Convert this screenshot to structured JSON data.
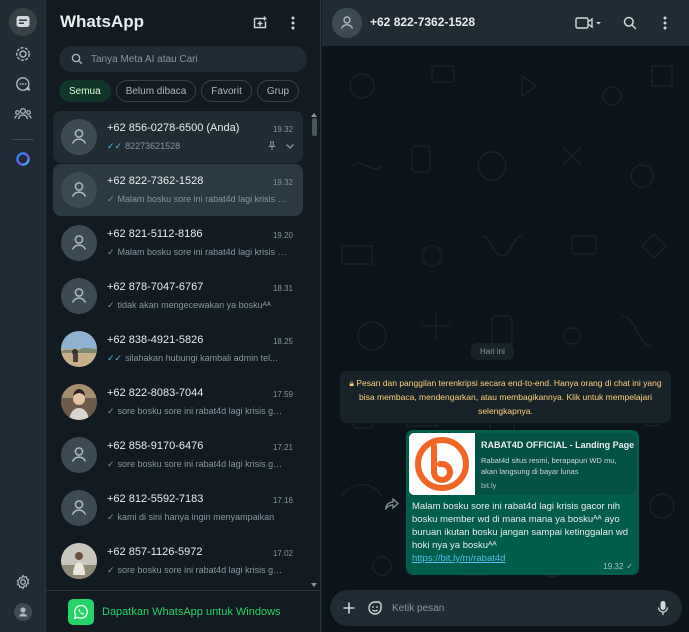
{
  "app": {
    "title": "WhatsApp"
  },
  "search": {
    "placeholder": "Tanya Meta AI atau Cari"
  },
  "filters": [
    "Semua",
    "Belum dibaca",
    "Favorit",
    "Grup"
  ],
  "chats": [
    {
      "name": "+62 856-0278-6500 (Anda)",
      "time": "19.32",
      "preview": "82273621528",
      "ticks": "read",
      "avatar": "placeholder",
      "pinned": true
    },
    {
      "name": "+62 822-7362-1528",
      "time": "19.32",
      "preview": "Malam  bosku sore ini rabat4d lagi krisis gacor nih bosku",
      "ticks": "sent",
      "avatar": "placeholder"
    },
    {
      "name": "+62 821-5112-8186",
      "time": "19.20",
      "preview": "Malam  bosku sore ini rabat4d lagi krisis gacor nih bosku",
      "ticks": "sent",
      "avatar": "placeholder"
    },
    {
      "name": "+62 878-7047-6767",
      "time": "18.31",
      "preview": "tidak akan mengecewakan ya boskuᴬᴬ",
      "ticks": "sent",
      "avatar": "placeholder"
    },
    {
      "name": "+62 838-4921-5826",
      "time": "18.25",
      "preview": "silahakan hubungi kambali admin tel...",
      "ticks": "read",
      "avatar": "photo-landscape"
    },
    {
      "name": "+62 822-8083-7044",
      "time": "17.59",
      "preview": "sore bosku sore ini rabat4d lagi krisis gacor",
      "ticks": "sent",
      "avatar": "photo-person"
    },
    {
      "name": "+62 858-9170-6476",
      "time": "17.21",
      "preview": "sore bosku sore ini rabat4d lagi krisis gacor",
      "ticks": "sent",
      "avatar": "placeholder"
    },
    {
      "name": "+62 812-5592-7183",
      "time": "17.16",
      "preview": "kami di sini hanya ingin menyampaikan",
      "ticks": "sent",
      "avatar": "placeholder"
    },
    {
      "name": "+62 857-1126-5972",
      "time": "17.02",
      "preview": "sore bosku sore ini rabat4d lagi krisis gacor",
      "ticks": "sent",
      "avatar": "photo-person2"
    }
  ],
  "windows_banner": {
    "label": "Dapatkan WhatsApp untuk Windows"
  },
  "conversation": {
    "contact": "+62 822-7362-1528",
    "date_divider": "Hari ini",
    "encryption_notice": "Pesan dan panggilan terenkripsi secara end-to-end. Hanya orang di chat ini yang bisa membaca, mendengarkan, atau membagikannya. Klik untuk mempelajari selengkapnya.",
    "message": {
      "link_title": "RABAT4D OFFICIAL - Landing Page",
      "link_description": "Rabat4d situs resmi, berapapun WD mu, akan langsung di bayar lunas",
      "link_domain": "bit.ly",
      "text": "Malam  bosku sore ini rabat4d lagi krisis gacor nih bosku member wd di mana mana ya boskuᴬᴬ ayo buruan ikutan bosku jangan sampai ketinggalan wd hoki nya ya boskuᴬᴬ",
      "url": "https://bit.ly/m/rabat4d",
      "time": "19.32"
    },
    "composer_placeholder": "Ketik pesan"
  },
  "colors": {
    "accent": "#25d366",
    "read_tick": "#53bdeb",
    "outgoing_bubble": "#005c4b",
    "notice": "#ffd279",
    "brand_orange": "#f26522"
  },
  "icons": [
    "chats-icon",
    "status-icon",
    "channels-icon",
    "communities-icon",
    "meta-ai-icon",
    "settings-icon",
    "profile-icon",
    "new-chat-icon",
    "menu-icon",
    "search-icon",
    "pin-icon",
    "chevron-down-icon",
    "video-call-icon",
    "attach-icon",
    "sticker-icon",
    "mic-icon",
    "forward-icon",
    "whatsapp-logo-icon"
  ]
}
